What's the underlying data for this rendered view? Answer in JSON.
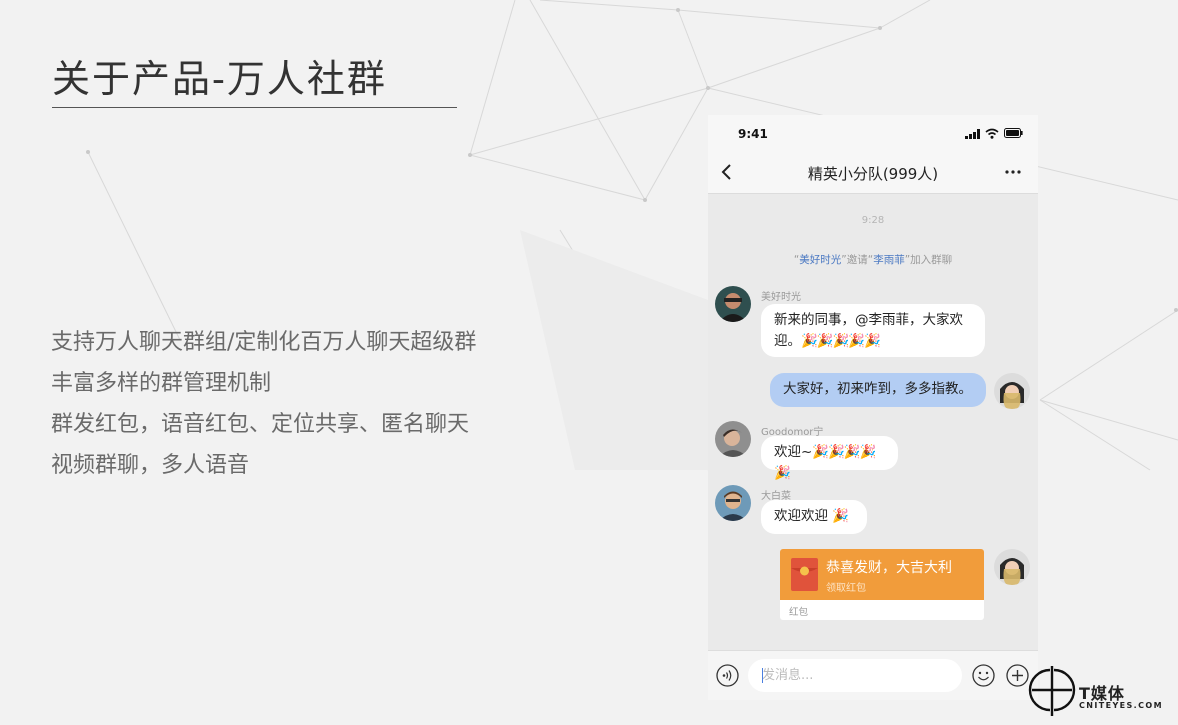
{
  "slide": {
    "title": "关于产品-万人社群",
    "features": [
      "支持万人聊天群组/定制化百万人聊天超级群",
      "丰富多样的群管理机制",
      "群发红包，语音红包、定位共享、匿名聊天",
      "视频群聊，多人语音"
    ]
  },
  "phone": {
    "status_time": "9:41",
    "chat_title": "精英小分队(999人)",
    "time_divider": "9:28",
    "system_message": {
      "inviter": "美好时光",
      "verb": "邀请",
      "invitee": "李雨菲",
      "suffix": "加入群聊"
    },
    "messages": [
      {
        "sender": "美好时光",
        "line1": "新来的同事，@李雨菲，大家欢",
        "line2": "迎。",
        "emoji": "🎉🎉🎉🎉🎉"
      },
      {
        "sender": "",
        "text": "大家好，初来咋到，多多指教。"
      },
      {
        "sender": "Goodomor宁",
        "text": "欢迎~",
        "emoji": "🎉🎉🎉🎉🎉"
      },
      {
        "sender": "大白菜",
        "text": "欢迎欢迎 ",
        "emoji": "🎉"
      }
    ],
    "red_packet": {
      "title": "恭喜发财，大吉大利",
      "subtitle": "领取红包",
      "label": "红包"
    },
    "input": {
      "placeholder": "发消息..."
    }
  },
  "brand": {
    "name": "T媒体",
    "domain": "CNITEYES.COM"
  },
  "colors": {
    "accent_blue": "#4a78c2",
    "mine_bubble": "#b3cdf3",
    "red_packet": "#f19c3b"
  }
}
